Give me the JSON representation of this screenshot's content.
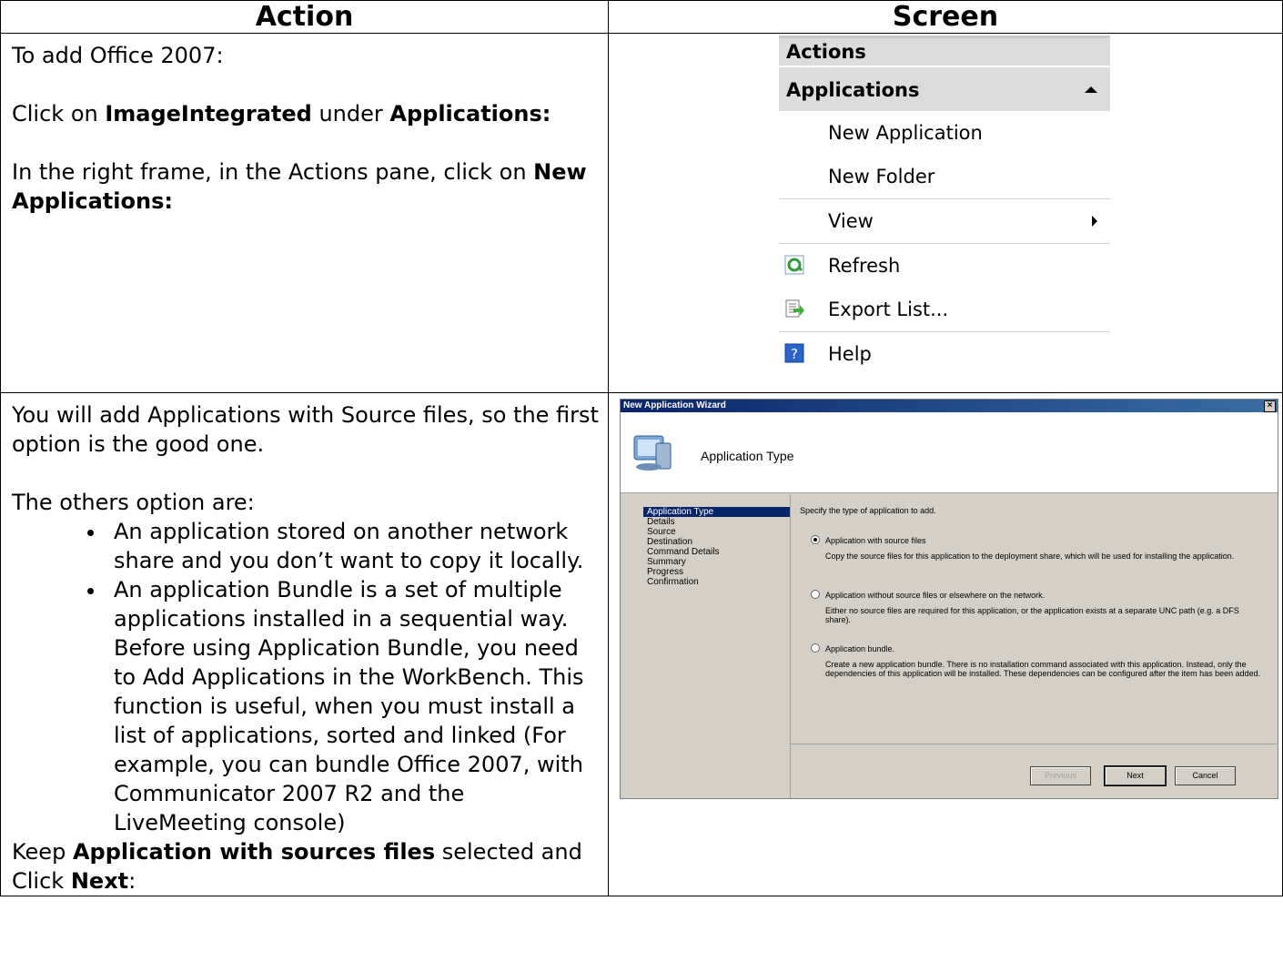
{
  "table": {
    "header_action": "Action",
    "header_screen": "Screen"
  },
  "row1": {
    "line1": "To add Office 2007:",
    "line2_pre": "Click on ",
    "line2_b1": "ImageIntegrated",
    "line2_mid": " under ",
    "line2_b2": "Applications:",
    "line3_pre": "In the right frame, in the Actions pane, click on ",
    "line3_b": "New Applications:"
  },
  "actions_pane": {
    "header": "Actions",
    "section": "Applications",
    "items": [
      "New Application",
      "New Folder",
      "View",
      "Refresh",
      "Export List...",
      "Help"
    ],
    "icons": [
      "refresh-icon",
      "export-list-icon",
      "help-icon"
    ]
  },
  "row2": {
    "p1": "You will add Applications with Source files, so the first option is the good one.",
    "p2": "The others option are:",
    "bullets": [
      "An application stored on another network share and you don’t want to copy it locally.",
      "An application Bundle is a set of multiple applications installed in a sequential way. Before using Application Bundle, you need to Add Applications in the WorkBench. This function is useful, when you must install a list of applications, sorted and linked (For example, you can bundle Office 2007, with Communicator 2007 R2 and the LiveMeeting console)"
    ],
    "p3_pre": "Keep ",
    "p3_b": "Application with sources files",
    "p3_mid": " selected and Click ",
    "p3_b2": "Next",
    "p3_end": ":"
  },
  "wizard": {
    "title": "New Application Wizard",
    "close": "×",
    "page_title": "Application Type",
    "nav": [
      "Application Type",
      "Details",
      "Source",
      "Destination",
      "Command Details",
      "Summary",
      "Progress",
      "Confirmation"
    ],
    "prompt": "Specify the type of application to add.",
    "options": [
      {
        "label": "Application with source files",
        "selected": true,
        "desc": "Copy the source files for this application to the deployment share, which will be used for installing the application."
      },
      {
        "label": "Application without source files or elsewhere on the network.",
        "selected": false,
        "desc": "Either no source files are required for this application, or the application exists at a separate UNC path (e.g. a DFS share)."
      },
      {
        "label": "Application bundle.",
        "selected": false,
        "desc": "Create a new application bundle.  There is no installation command associated with this application.  Instead, only the dependencies of this application will be installed.  These dependencies can be configured after the item has been added."
      }
    ],
    "buttons": {
      "previous": "Previous",
      "next": "Next",
      "cancel": "Cancel"
    }
  }
}
